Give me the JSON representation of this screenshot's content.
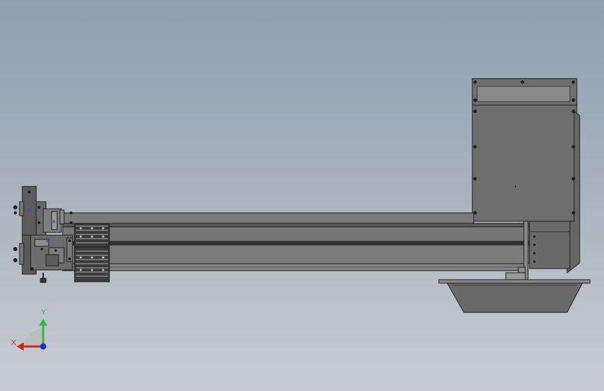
{
  "viewport": {
    "background_top": "#8f9fb1",
    "background_bottom": "#c9cdd1"
  },
  "model": {
    "components": [
      "motor-housing",
      "horizontal-beam",
      "drive-assembly",
      "bracket-stack",
      "feed-hopper"
    ],
    "colors": {
      "housing": "#6e6e6e",
      "beam": "#777777",
      "hopper": "#6a6a6a",
      "edge": "#1c1c1c"
    }
  },
  "triad": {
    "y_label": "Y",
    "x_label": "X",
    "y_color": "#2fb84a",
    "x_color": "#d02020",
    "z_color": "#2030d0"
  }
}
